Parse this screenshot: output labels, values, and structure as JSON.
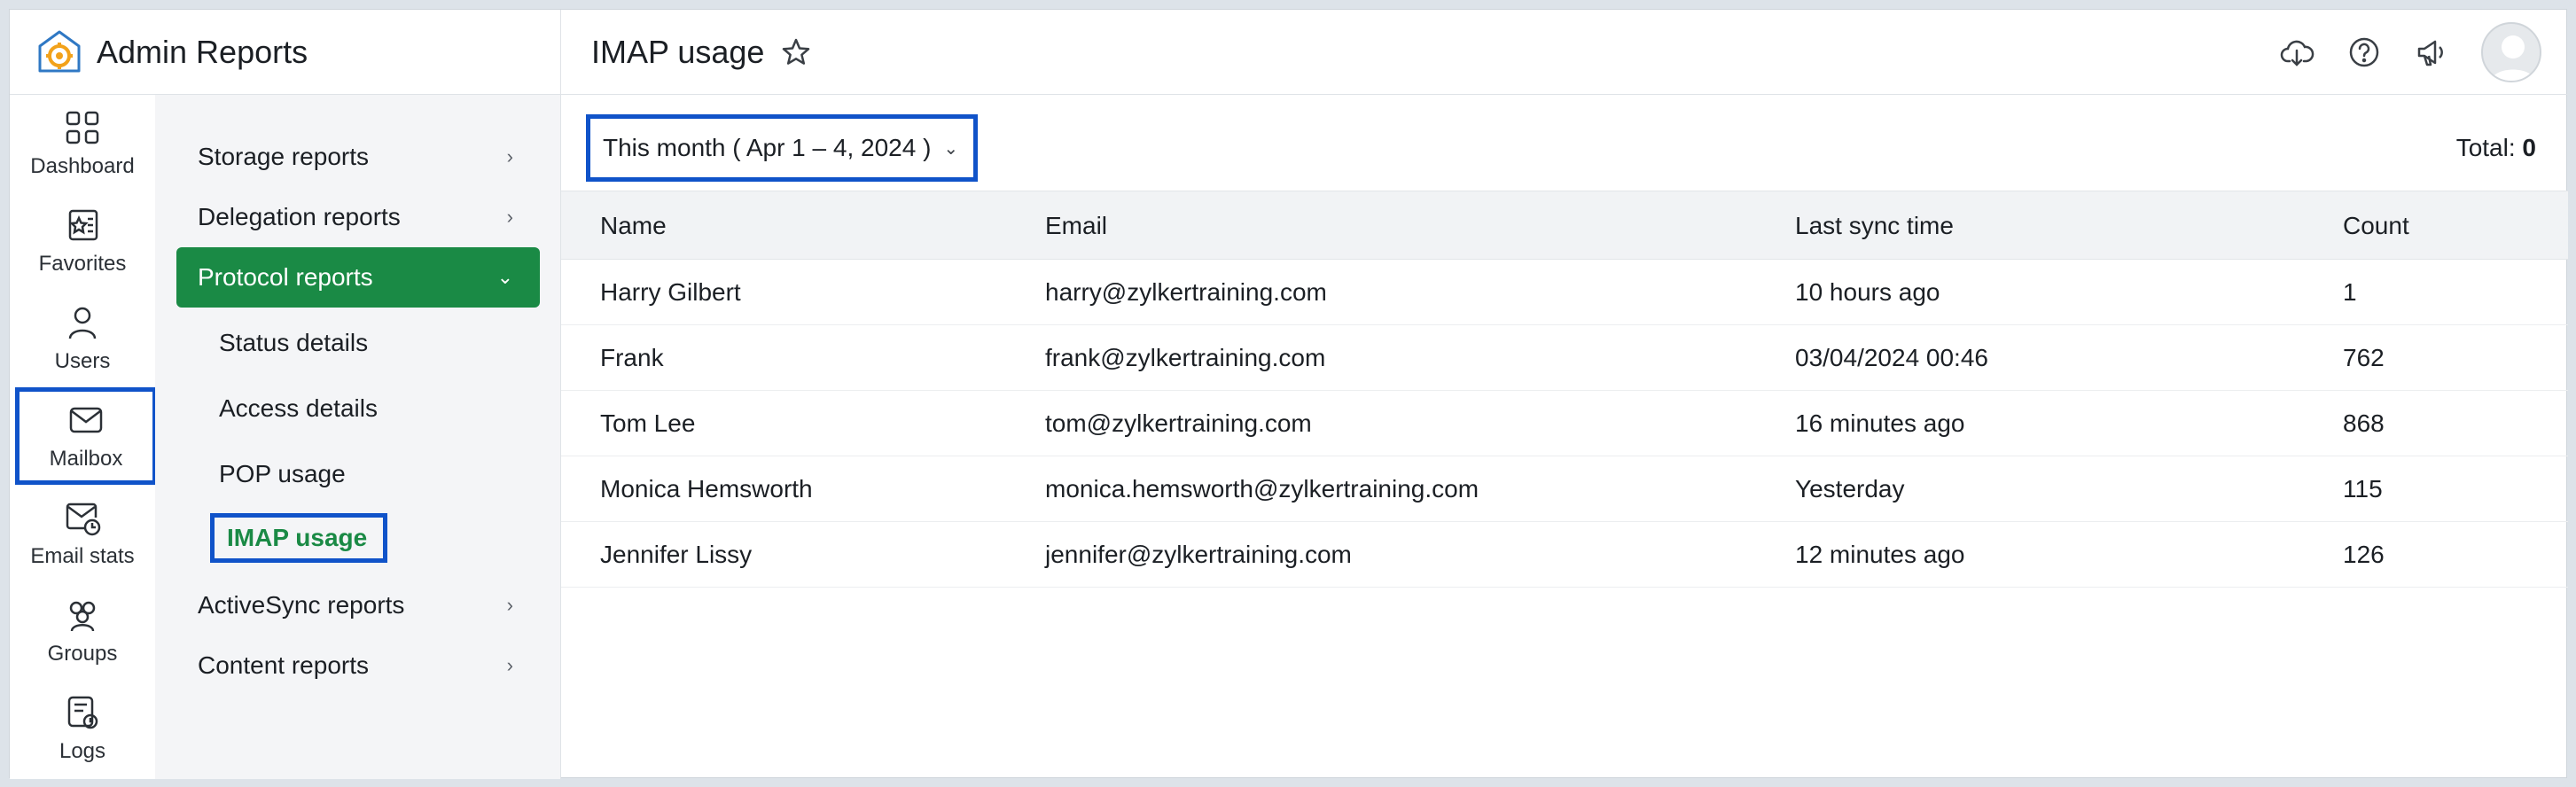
{
  "app": {
    "title": "Admin Reports"
  },
  "rail": [
    {
      "label": "Dashboard",
      "icon": "dashboard-icon"
    },
    {
      "label": "Favorites",
      "icon": "favorites-icon"
    },
    {
      "label": "Users",
      "icon": "users-icon"
    },
    {
      "label": "Mailbox",
      "icon": "mailbox-icon",
      "active": true
    },
    {
      "label": "Email stats",
      "icon": "email-stats-icon"
    },
    {
      "label": "Groups",
      "icon": "groups-icon"
    },
    {
      "label": "Logs",
      "icon": "logs-icon"
    }
  ],
  "nav": {
    "storage": "Storage reports",
    "delegation": "Delegation reports",
    "protocol": "Protocol reports",
    "sub": [
      "Status details",
      "Access details",
      "POP usage",
      "IMAP usage"
    ],
    "activesync": "ActiveSync reports",
    "content": "Content reports",
    "chev_right": "›",
    "chev_down": "⌄"
  },
  "header": {
    "title": "IMAP usage"
  },
  "filter": {
    "label": "This month ( Apr 1 – 4, 2024 )",
    "chev": "⌄"
  },
  "total": {
    "label": "Total:",
    "value": "0"
  },
  "table": {
    "headers": {
      "name": "Name",
      "email": "Email",
      "sync": "Last sync time",
      "count": "Count"
    },
    "rows": [
      {
        "name": "Harry Gilbert",
        "email": "harry@zylkertraining.com",
        "sync": "10 hours ago",
        "count": "1"
      },
      {
        "name": "Frank",
        "email": "frank@zylkertraining.com",
        "sync": "03/04/2024 00:46",
        "count": "762"
      },
      {
        "name": "Tom Lee",
        "email": "tom@zylkertraining.com",
        "sync": "16 minutes ago",
        "count": "868"
      },
      {
        "name": "Monica Hemsworth",
        "email": "monica.hemsworth@zylkertraining.com",
        "sync": "Yesterday",
        "count": "115"
      },
      {
        "name": "Jennifer Lissy",
        "email": "jennifer@zylkertraining.com",
        "sync": "12 minutes ago",
        "count": "126"
      }
    ]
  },
  "colors": {
    "accent_green": "#1a8a45",
    "highlight_blue": "#1053c9",
    "logo_orange": "#f2a21b",
    "logo_blue": "#2f78c4"
  }
}
